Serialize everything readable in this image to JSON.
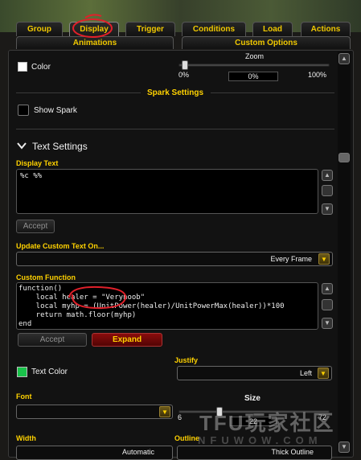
{
  "tabs_row1": [
    "Group",
    "Display",
    "Trigger",
    "Conditions",
    "Load",
    "Actions"
  ],
  "tabs_row2": [
    "Animations",
    "Custom Options"
  ],
  "color": {
    "label": "Color"
  },
  "zoom": {
    "label": "Zoom",
    "min": "0%",
    "max": "100%",
    "value": "0%",
    "fraction": 0
  },
  "spark": {
    "heading": "Spark Settings",
    "show_label": "Show Spark"
  },
  "text_settings": {
    "heading": "Text Settings"
  },
  "display_text": {
    "label": "Display Text",
    "value": "%c %%",
    "accept": "Accept"
  },
  "update_custom": {
    "label": "Update Custom Text On...",
    "value": "Every Frame"
  },
  "custom_function": {
    "label": "Custom Function",
    "lines": [
      "function()",
      "    local healer = \"Verynoob\"",
      "    local myhp = (UnitPower(healer)/UnitPowerMax(healer))*100",
      "    return math.floor(myhp)",
      "end"
    ],
    "accept": "Accept",
    "expand": "Expand"
  },
  "text_color": {
    "label": "Text Color",
    "swatch": "#19c24a"
  },
  "justify": {
    "label": "Justify",
    "value": "Left"
  },
  "font": {
    "label": "Font",
    "value": ""
  },
  "size": {
    "label": "Size",
    "min": "6",
    "max": "72",
    "value": "22",
    "fraction": 0.24
  },
  "width": {
    "label": "Width",
    "value": "Automatic"
  },
  "outline": {
    "label": "Outline",
    "value": "Thick Outline"
  },
  "watermark": {
    "main": "TFU玩家社区",
    "sub": "NFUWOW.COM"
  },
  "colors": {
    "accent": "#ffd200",
    "annotation": "#e0202a"
  }
}
